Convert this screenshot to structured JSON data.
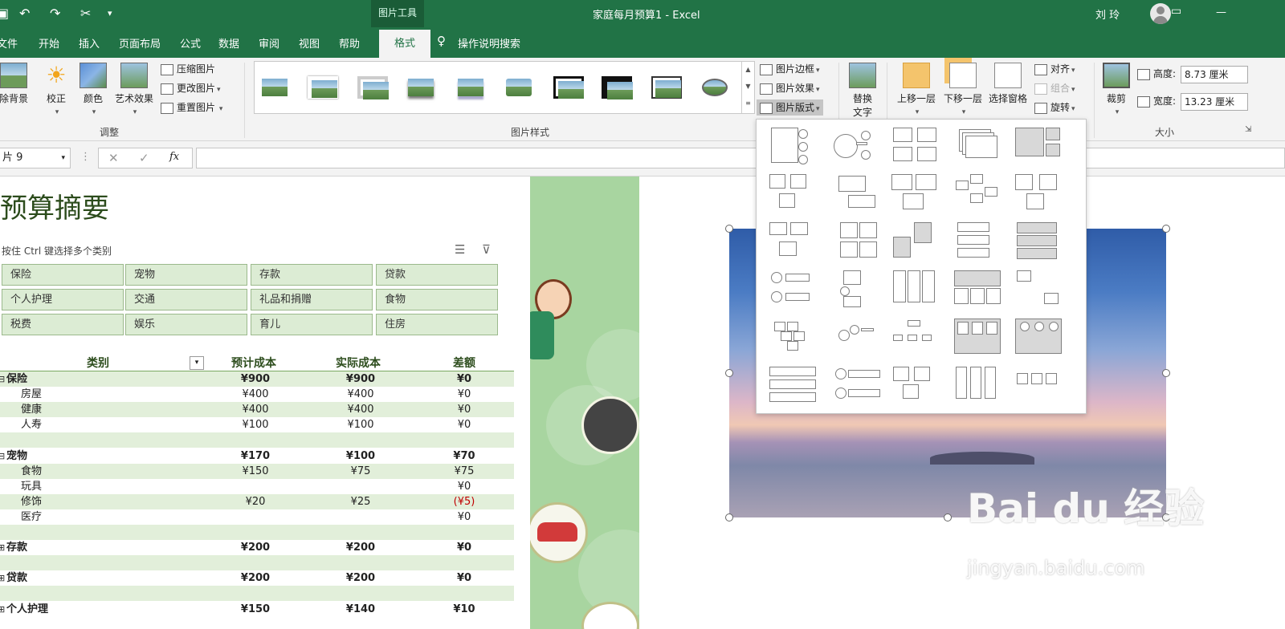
{
  "window": {
    "title": "家庭每月预算1  -  Excel",
    "context_tools": "图片工具",
    "user": "刘 玲"
  },
  "tabs": [
    "文件",
    "开始",
    "插入",
    "页面布局",
    "公式",
    "数据",
    "审阅",
    "视图",
    "帮助",
    "格式"
  ],
  "tell_me": "操作说明搜索",
  "ribbon": {
    "adjust": {
      "remove_bg": "除背景",
      "corrections": "校正",
      "color": "颜色",
      "artistic": "艺术效果",
      "compress": "压缩图片",
      "change": "更改图片",
      "reset": "重置图片",
      "group_label": "调整"
    },
    "styles": {
      "border": "图片边框",
      "effects": "图片效果",
      "layout": "图片版式",
      "group_label": "图片样式"
    },
    "accessibility": {
      "alt_text_1": "替换",
      "alt_text_2": "文字"
    },
    "arrange": {
      "forward": "上移一层",
      "backward": "下移一层",
      "pane": "选择窗格",
      "align": "对齐",
      "group": "组合",
      "rotate": "旋转"
    },
    "size": {
      "crop": "裁剪",
      "height_label": "高度:",
      "height_value": "8.73 厘米",
      "width_label": "宽度:",
      "width_value": "13.23 厘米",
      "group_label": "大小"
    }
  },
  "formula_bar": {
    "name_box": "片 9",
    "fx": "fx"
  },
  "sheet": {
    "title": "预算摘要",
    "hint": "按住 Ctrl 键选择多个类别",
    "slicers": [
      "保险",
      "宠物",
      "存款",
      "贷款",
      "个人护理",
      "交通",
      "礼品和捐赠",
      "食物",
      "税费",
      "娱乐",
      "育儿",
      "住房"
    ],
    "headers": {
      "category": "类别",
      "budget": "预计成本",
      "actual": "实际成本",
      "diff": "差额"
    },
    "rows": [
      {
        "name": "保险",
        "budget": "¥900",
        "actual": "¥900",
        "diff": "¥0",
        "type": "group",
        "mark": "⊟"
      },
      {
        "name": "房屋",
        "budget": "¥400",
        "actual": "¥400",
        "diff": "¥0",
        "type": "item"
      },
      {
        "name": "健康",
        "budget": "¥400",
        "actual": "¥400",
        "diff": "¥0",
        "type": "item"
      },
      {
        "name": "人寿",
        "budget": "¥100",
        "actual": "¥100",
        "diff": "¥0",
        "type": "item"
      },
      {
        "name": "",
        "budget": "",
        "actual": "",
        "diff": "",
        "type": "blank"
      },
      {
        "name": "宠物",
        "budget": "¥170",
        "actual": "¥100",
        "diff": "¥70",
        "type": "group",
        "mark": "⊟"
      },
      {
        "name": "食物",
        "budget": "¥150",
        "actual": "¥75",
        "diff": "¥75",
        "type": "item"
      },
      {
        "name": "玩具",
        "budget": "",
        "actual": "",
        "diff": "¥0",
        "type": "item"
      },
      {
        "name": "修饰",
        "budget": "¥20",
        "actual": "¥25",
        "diff": "(¥5)",
        "type": "item",
        "negative": true
      },
      {
        "name": "医疗",
        "budget": "",
        "actual": "",
        "diff": "¥0",
        "type": "item"
      },
      {
        "name": "",
        "budget": "",
        "actual": "",
        "diff": "",
        "type": "blank"
      },
      {
        "name": "存款",
        "budget": "¥200",
        "actual": "¥200",
        "diff": "¥0",
        "type": "group",
        "mark": "⊞"
      },
      {
        "name": "",
        "budget": "",
        "actual": "",
        "diff": "",
        "type": "blank"
      },
      {
        "name": "贷款",
        "budget": "¥200",
        "actual": "¥200",
        "diff": "¥0",
        "type": "group",
        "mark": "⊞"
      },
      {
        "name": "",
        "budget": "",
        "actual": "",
        "diff": "",
        "type": "blank"
      },
      {
        "name": "个人护理",
        "budget": "¥150",
        "actual": "¥140",
        "diff": "¥10",
        "type": "group",
        "mark": "⊞"
      }
    ]
  },
  "watermark": {
    "line1": "Bai du 经验",
    "line2": "jingyan.baidu.com"
  },
  "colors": {
    "excel_green": "#217346",
    "band": "#e2efda",
    "negative": "#c00000"
  }
}
